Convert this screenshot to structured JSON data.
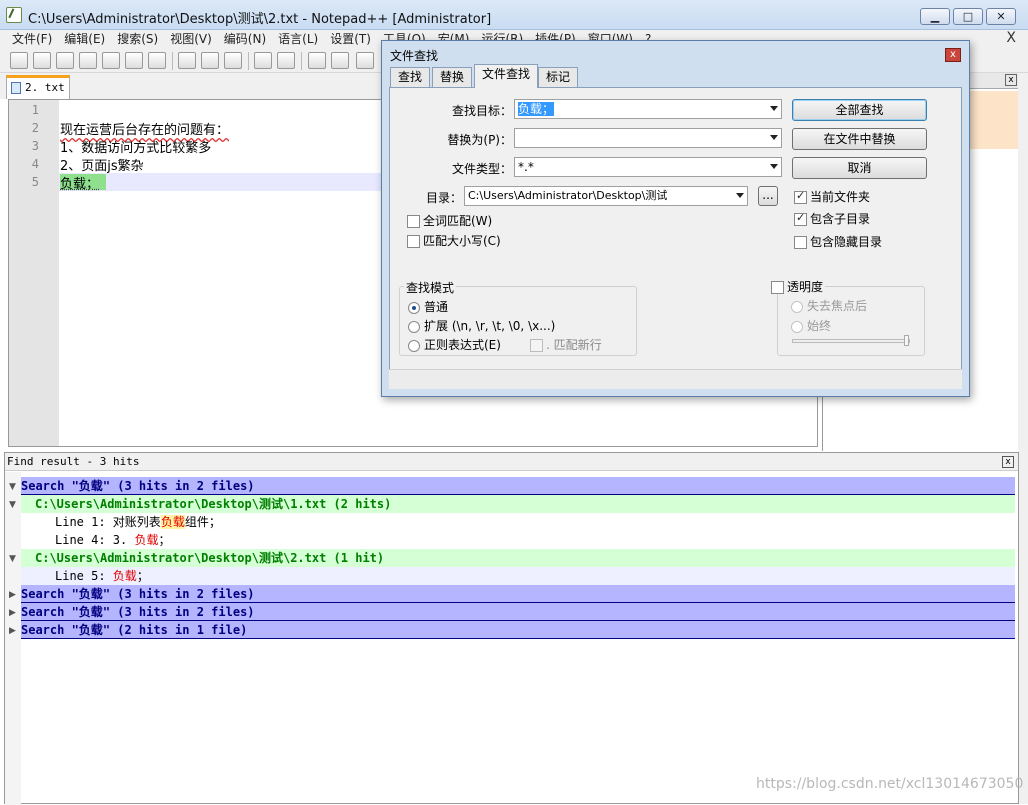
{
  "window": {
    "title": "C:\\Users\\Administrator\\Desktop\\测试\\2.txt - Notepad++ [Administrator]",
    "minimize": "▁",
    "maximize": "□",
    "close": "✕"
  },
  "menu": [
    "文件(F)",
    "编辑(E)",
    "搜索(S)",
    "视图(V)",
    "编码(N)",
    "语言(L)",
    "设置(T)",
    "工具(O)",
    "宏(M)",
    "运行(R)",
    "插件(P)",
    "窗口(W)",
    "?"
  ],
  "menu_close": "X",
  "tab": {
    "label": "2. txt"
  },
  "editor": {
    "line_numbers": [
      "1",
      "2",
      "3",
      "4",
      "5"
    ],
    "lines": [
      "",
      "现在运营后台存在的问题有：",
      "1、数据访问方式比较繁多",
      "2、页面js繁杂",
      "负载；"
    ]
  },
  "find_results": {
    "header": "Find result - 3 hits",
    "close": "x",
    "search1": {
      "prefix": "Search \"",
      "term": "负载",
      "suffix": "\" (3 hits in 2 files)"
    },
    "file1": {
      "prefix": "C:\\Users\\Administrator\\Desktop\\",
      "dir": "测试",
      "suffix": "\\1.txt (2 hits)"
    },
    "hit1": {
      "prefix": "Line 1: 对账列表",
      "term": "负载",
      "suffix": "组件；"
    },
    "hit2": {
      "prefix": "Line 4: 3. ",
      "term": "负载",
      "suffix": "；"
    },
    "file2": {
      "prefix": "C:\\Users\\Administrator\\Desktop\\",
      "dir": "测试",
      "suffix": "\\2.txt (1 hit)"
    },
    "hit3": {
      "prefix": "Line 5: ",
      "term": "负载",
      "suffix": "；"
    },
    "search2": {
      "prefix": "Search \"",
      "term": "负载",
      "suffix": "\" (3 hits in 2 files)"
    },
    "search3": {
      "prefix": "Search \"",
      "term": "负载",
      "suffix": "\" (3 hits in 2 files)"
    },
    "search4": {
      "prefix": "Search \"",
      "term": "负载",
      "suffix": "\" (2 hits in 1 file)"
    }
  },
  "dialog": {
    "title": "文件查找",
    "close": "x",
    "tabs": [
      "查找",
      "替换",
      "文件查找",
      "标记"
    ],
    "find_label": "查找目标：",
    "find_value": "负载；",
    "replace_label": "替换为(P)：",
    "replace_value": "",
    "filter_label": "文件类型：",
    "filter_value": "*.*",
    "dir_label": "目录：",
    "dir_value": "C:\\Users\\Administrator\\Desktop\\测试",
    "browse": "...",
    "btn_find_all": "全部查找",
    "btn_replace_in_files": "在文件中替换",
    "btn_cancel": "取消",
    "chk_current_folder": "当前文件夹",
    "chk_subfolders": "包含子目录",
    "chk_hidden": "包含隐藏目录",
    "chk_whole_word": "全词匹配(W)",
    "chk_match_case": "匹配大小写(C)",
    "search_mode_title": "查找模式",
    "radio_normal": "普通",
    "radio_extended": "扩展 (\\n, \\r, \\t, \\0, \\x...)",
    "radio_regex": "正则表达式(E)",
    "chk_dot_newline": ". 匹配新行",
    "transparency_title": "透明度",
    "radio_on_lose_focus": "失去焦点后",
    "radio_always": "始终"
  },
  "watermark": "https://blog.csdn.net/xcl13014673050"
}
